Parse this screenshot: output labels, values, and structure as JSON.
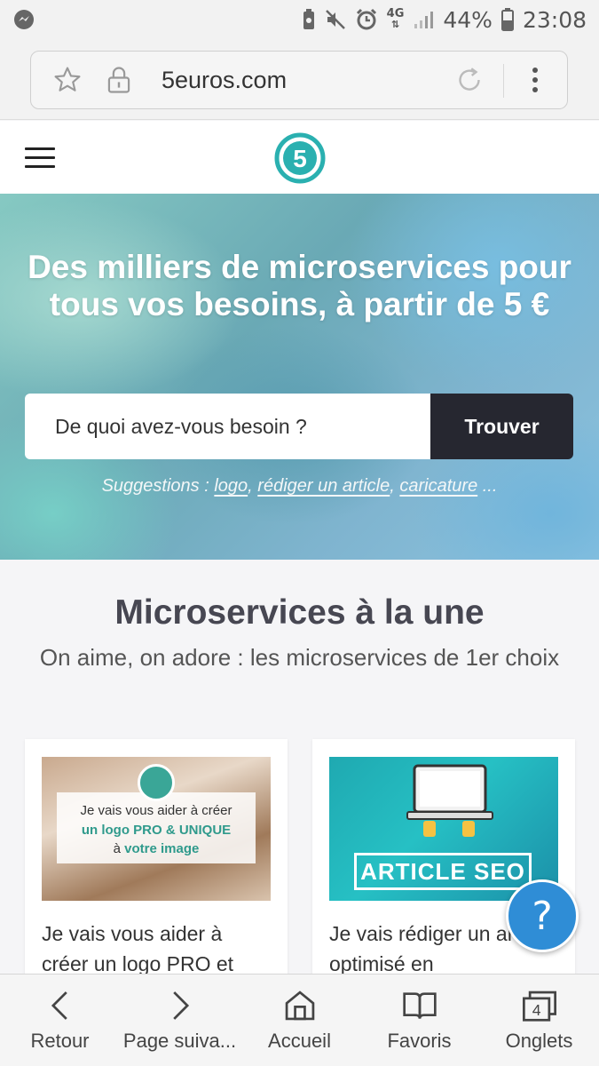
{
  "status_bar": {
    "left_icon": "messenger-icon",
    "battery": "44%",
    "time": "23:08",
    "network": "4G"
  },
  "browser": {
    "url": "5euros.com"
  },
  "site": {
    "logo_text": "5"
  },
  "hero": {
    "title": "Des milliers de microservices pour tous vos besoins, à partir de 5 €",
    "search_placeholder": "De quoi avez-vous besoin ?",
    "search_button": "Trouver",
    "suggestions_prefix": "Suggestions :",
    "suggestions": [
      "logo",
      "rédiger un article",
      "caricature"
    ],
    "suggestions_suffix": "..."
  },
  "featured": {
    "title": "Microservices à la une",
    "subtitle": "On aime, on adore : les microservices de 1er choix",
    "cards": [
      {
        "image_line1": "Je vais vous aider à créer",
        "image_line2": "un logo PRO & UNIQUE",
        "image_line3a": "à",
        "image_line3b": "votre image",
        "text": "Je vais vous aider à créer un logo PRO et"
      },
      {
        "image_banner": "ARTICLE SEO",
        "text": "Je vais rédiger un article optimisé en"
      }
    ]
  },
  "help_button": "?",
  "bottom_nav": {
    "items": [
      {
        "label": "Retour",
        "icon": "back-icon"
      },
      {
        "label": "Page suiva...",
        "icon": "forward-icon"
      },
      {
        "label": "Accueil",
        "icon": "home-icon"
      },
      {
        "label": "Favoris",
        "icon": "bookmarks-icon"
      },
      {
        "label": "Onglets",
        "icon": "tabs-icon",
        "count": "4"
      }
    ]
  },
  "colors": {
    "accent_teal": "#2ab0b0",
    "search_button_bg": "#262730",
    "help_blue": "#2f8dd6"
  }
}
